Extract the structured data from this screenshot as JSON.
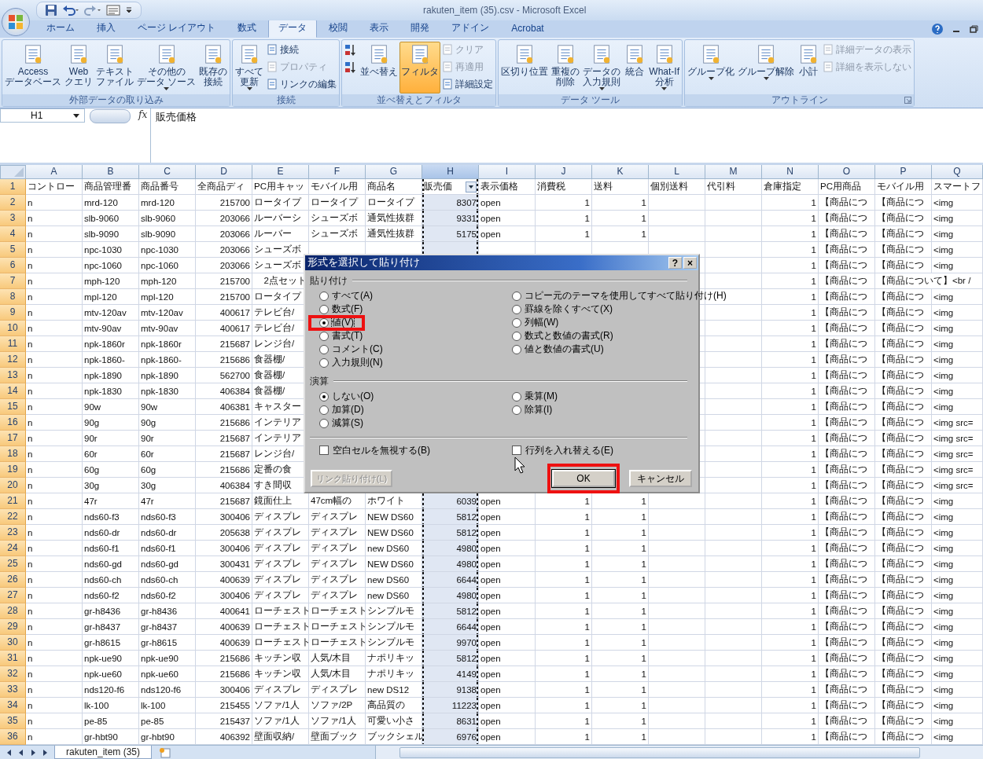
{
  "window": {
    "title": "rakuten_item (35).csv - Microsoft Excel"
  },
  "tabs": [
    {
      "label": "ホーム",
      "selected": false
    },
    {
      "label": "挿入",
      "selected": false
    },
    {
      "label": "ページ レイアウト",
      "selected": false
    },
    {
      "label": "数式",
      "selected": false
    },
    {
      "label": "データ",
      "selected": true
    },
    {
      "label": "校閲",
      "selected": false
    },
    {
      "label": "表示",
      "selected": false
    },
    {
      "label": "開発",
      "selected": false
    },
    {
      "label": "アドイン",
      "selected": false
    },
    {
      "label": "Acrobat",
      "selected": false
    }
  ],
  "ribbon": {
    "groups": [
      {
        "label": "外部データの取り込み",
        "buttons": [
          {
            "kind": "large",
            "lines": [
              "Access",
              "データベース"
            ]
          },
          {
            "kind": "large",
            "lines": [
              "Web",
              "クエリ"
            ]
          },
          {
            "kind": "large",
            "lines": [
              "テキスト",
              "ファイル"
            ]
          },
          {
            "kind": "large",
            "lines": [
              "その他の",
              "データ ソース"
            ],
            "dropdown": true
          },
          {
            "kind": "large",
            "lines": [
              "既存の",
              "接続"
            ]
          }
        ]
      },
      {
        "label": "接続",
        "buttons": [
          {
            "kind": "large",
            "lines": [
              "すべて",
              "更新"
            ],
            "dropdown": true
          },
          {
            "kind": "small",
            "lines": [
              "接続"
            ]
          },
          {
            "kind": "small",
            "lines": [
              "プロパティ"
            ],
            "disabled": true
          },
          {
            "kind": "small",
            "lines": [
              "リンクの編集"
            ]
          }
        ]
      },
      {
        "label": "並べ替えとフィルタ",
        "buttons": [
          {
            "kind": "icon"
          },
          {
            "kind": "icon"
          },
          {
            "kind": "large",
            "lines": [
              "並べ替え"
            ]
          },
          {
            "kind": "large",
            "lines": [
              "フィルタ"
            ],
            "selected": true
          },
          {
            "kind": "small",
            "lines": [
              "クリア"
            ],
            "disabled": true
          },
          {
            "kind": "small",
            "lines": [
              "再適用"
            ],
            "disabled": true
          },
          {
            "kind": "small",
            "lines": [
              "詳細設定"
            ]
          }
        ]
      },
      {
        "label": "データ ツール",
        "buttons": [
          {
            "kind": "large",
            "lines": [
              "区切り位置"
            ]
          },
          {
            "kind": "large",
            "lines": [
              "重複の",
              "削除"
            ]
          },
          {
            "kind": "large",
            "lines": [
              "データの",
              "入力規則"
            ],
            "dropdown": true
          },
          {
            "kind": "large",
            "lines": [
              "統合"
            ]
          },
          {
            "kind": "large",
            "lines": [
              "What-If",
              "分析"
            ],
            "dropdown": true
          }
        ]
      },
      {
        "label": "アウトライン",
        "has_launcher": true,
        "buttons": [
          {
            "kind": "large",
            "lines": [
              "グループ化"
            ],
            "dropdown": true
          },
          {
            "kind": "large",
            "lines": [
              "グループ解除"
            ],
            "dropdown": true
          },
          {
            "kind": "large",
            "lines": [
              "小計"
            ]
          },
          {
            "kind": "small",
            "lines": [
              "詳細データの表示"
            ],
            "disabled": true
          },
          {
            "kind": "small",
            "lines": [
              "詳細を表示しない"
            ],
            "disabled": true
          }
        ]
      }
    ]
  },
  "formula_bar": {
    "name_box": "H1",
    "fx_label": "fx",
    "value": "販売価格"
  },
  "sheet": {
    "columns": [
      {
        "label": "A",
        "selected": false
      },
      {
        "label": "B",
        "selected": false
      },
      {
        "label": "C",
        "selected": false
      },
      {
        "label": "D",
        "selected": false
      },
      {
        "label": "E",
        "selected": false
      },
      {
        "label": "F",
        "selected": false
      },
      {
        "label": "G",
        "selected": false
      },
      {
        "label": "H",
        "selected": true
      },
      {
        "label": "I",
        "selected": false
      },
      {
        "label": "J",
        "selected": false
      },
      {
        "label": "K",
        "selected": false
      },
      {
        "label": "L",
        "selected": false
      },
      {
        "label": "M",
        "selected": false
      },
      {
        "label": "N",
        "selected": false
      },
      {
        "label": "O",
        "selected": false
      },
      {
        "label": "P",
        "selected": false
      },
      {
        "label": "Q",
        "selected": false
      }
    ],
    "rows": [
      {
        "num": "1",
        "cells": [
          "コントロー",
          "商品管理番",
          "商品番号",
          "全商品ディ",
          "PC用キャッ",
          "モバイル用",
          "商品名",
          "販売価",
          "表示価格",
          "消費税",
          "送料",
          "個別送料",
          "代引料",
          "倉庫指定",
          "PC用商品",
          "モバイル用",
          "スマートフ"
        ]
      },
      {
        "num": "2",
        "cells": [
          "n",
          "mrd-120",
          "mrd-120",
          "215700",
          "ロータイプ",
          "ロータイプ",
          "ロータイプ",
          "8307",
          "open",
          "1",
          "1",
          null,
          null,
          "1",
          "【商品につ",
          "【商品につ",
          "<img"
        ]
      },
      {
        "num": "3",
        "cells": [
          "n",
          "slb-9060",
          "slb-9060",
          "203066",
          "ルーバーシ",
          "シューズボ",
          "通気性抜群",
          "9331",
          "open",
          "1",
          "1",
          null,
          null,
          "1",
          "【商品につ",
          "【商品につ",
          "<img"
        ]
      },
      {
        "num": "4",
        "cells": [
          "n",
          "slb-9090",
          "slb-9090",
          "203066",
          "ルーバー",
          "シューズボ",
          "通気性抜群",
          "5175",
          "open",
          "1",
          "1",
          null,
          null,
          "1",
          "【商品につ",
          "【商品につ",
          "<img"
        ]
      },
      {
        "num": "5",
        "cells": [
          "n",
          "npc-1030",
          "npc-1030",
          "203066",
          "シューズボ",
          null,
          null,
          null,
          null,
          null,
          null,
          null,
          null,
          "1",
          "【商品につ",
          "【商品につ",
          "<img"
        ]
      },
      {
        "num": "6",
        "cells": [
          "n",
          "npc-1060",
          "npc-1060",
          "203066",
          "シューズボ",
          null,
          null,
          null,
          null,
          null,
          null,
          null,
          null,
          "1",
          "【商品につ",
          "【商品につ",
          "<img"
        ]
      },
      {
        "num": "7",
        "cells": [
          "n",
          "mph-120",
          "mph-120",
          "215700",
          "2点セット",
          null,
          null,
          null,
          null,
          null,
          null,
          null,
          null,
          "1",
          "【商品につ",
          "【商品について】<br /",
          null
        ]
      },
      {
        "num": "8",
        "cells": [
          "n",
          "mpl-120",
          "mpl-120",
          "215700",
          "ロータイプ",
          null,
          null,
          null,
          null,
          null,
          null,
          null,
          null,
          "1",
          "【商品につ",
          "【商品につ",
          "<img"
        ]
      },
      {
        "num": "9",
        "cells": [
          "n",
          "mtv-120av",
          "mtv-120av",
          "400617",
          "テレビ台/",
          null,
          null,
          null,
          null,
          null,
          null,
          null,
          null,
          "1",
          "【商品につ",
          "【商品につ",
          "<img"
        ]
      },
      {
        "num": "10",
        "cells": [
          "n",
          "mtv-90av",
          "mtv-90av",
          "400617",
          "テレビ台/",
          null,
          null,
          null,
          null,
          null,
          null,
          null,
          null,
          "1",
          "【商品につ",
          "【商品につ",
          "<img"
        ]
      },
      {
        "num": "11",
        "cells": [
          "n",
          "npk-1860r",
          "npk-1860r",
          "215687",
          "レンジ台/",
          null,
          null,
          null,
          null,
          null,
          null,
          null,
          null,
          "1",
          "【商品につ",
          "【商品につ",
          "<img"
        ]
      },
      {
        "num": "12",
        "cells": [
          "n",
          "npk-1860-",
          "npk-1860-",
          "215686",
          "食器棚/",
          null,
          null,
          null,
          null,
          null,
          null,
          null,
          null,
          "1",
          "【商品につ",
          "【商品につ",
          "<img"
        ]
      },
      {
        "num": "13",
        "cells": [
          "n",
          "npk-1890",
          "npk-1890",
          "562700",
          "食器棚/",
          null,
          null,
          null,
          null,
          null,
          null,
          null,
          null,
          "1",
          "【商品につ",
          "【商品につ",
          "<img"
        ]
      },
      {
        "num": "14",
        "cells": [
          "n",
          "npk-1830",
          "npk-1830",
          "406384",
          "食器棚/",
          null,
          null,
          null,
          null,
          null,
          null,
          null,
          null,
          "1",
          "【商品につ",
          "【商品につ",
          "<img"
        ]
      },
      {
        "num": "15",
        "cells": [
          "n",
          "90w",
          "90w",
          "406381",
          "キャスター",
          null,
          null,
          null,
          null,
          null,
          null,
          null,
          null,
          "1",
          "【商品につ",
          "【商品につ",
          "<img"
        ]
      },
      {
        "num": "16",
        "cells": [
          "n",
          "90g",
          "90g",
          "215686",
          "インテリア",
          null,
          null,
          null,
          null,
          null,
          null,
          null,
          null,
          "1",
          "【商品につ",
          "【商品につ",
          "<img src="
        ]
      },
      {
        "num": "17",
        "cells": [
          "n",
          "90r",
          "90r",
          "215687",
          "インテリア",
          null,
          null,
          null,
          null,
          null,
          null,
          null,
          null,
          "1",
          "【商品につ",
          "【商品につ",
          "<img src="
        ]
      },
      {
        "num": "18",
        "cells": [
          "n",
          "60r",
          "60r",
          "215687",
          "レンジ台/",
          null,
          null,
          null,
          null,
          null,
          null,
          null,
          null,
          "1",
          "【商品につ",
          "【商品につ",
          "<img src="
        ]
      },
      {
        "num": "19",
        "cells": [
          "n",
          "60g",
          "60g",
          "215686",
          "定番の食",
          null,
          null,
          null,
          null,
          null,
          null,
          null,
          null,
          "1",
          "【商品につ",
          "【商品につ",
          "<img src="
        ]
      },
      {
        "num": "20",
        "cells": [
          "n",
          "30g",
          "30g",
          "406384",
          "すき間収",
          null,
          null,
          null,
          null,
          null,
          null,
          null,
          null,
          "1",
          "【商品につ",
          "【商品につ",
          "<img src="
        ]
      },
      {
        "num": "21",
        "cells": [
          "n",
          "47r",
          "47r",
          "215687",
          "鏡面仕上",
          "47cm幅の",
          "ホワイト",
          "6039",
          "open",
          "1",
          "1",
          null,
          null,
          "1",
          "【商品につ",
          "【商品につ",
          "<img"
        ]
      },
      {
        "num": "22",
        "cells": [
          "n",
          "nds60-f3",
          "nds60-f3",
          "300406",
          "ディスプレ",
          "ディスプレ",
          "NEW DS60",
          "5812",
          "open",
          "1",
          "1",
          null,
          null,
          "1",
          "【商品につ",
          "【商品につ",
          "<img"
        ]
      },
      {
        "num": "23",
        "cells": [
          "n",
          "nds60-dr",
          "nds60-dr",
          "205638",
          "ディスプレ",
          "ディスプレ",
          "NEW DS60",
          "5812",
          "open",
          "1",
          "1",
          null,
          null,
          "1",
          "【商品につ",
          "【商品につ",
          "<img"
        ]
      },
      {
        "num": "24",
        "cells": [
          "n",
          "nds60-f1",
          "nds60-f1",
          "300406",
          "ディスプレ",
          "ディスプレ",
          "new DS60",
          "4980",
          "open",
          "1",
          "1",
          null,
          null,
          "1",
          "【商品につ",
          "【商品につ",
          "<img"
        ]
      },
      {
        "num": "25",
        "cells": [
          "n",
          "nds60-gd",
          "nds60-gd",
          "300431",
          "ディスプレ",
          "ディスプレ",
          "NEW DS60",
          "4980",
          "open",
          "1",
          "1",
          null,
          null,
          "1",
          "【商品につ",
          "【商品につ",
          "<img"
        ]
      },
      {
        "num": "26",
        "cells": [
          "n",
          "nds60-ch",
          "nds60-ch",
          "400639",
          "ディスプレ",
          "ディスプレ",
          "new DS60",
          "6644",
          "open",
          "1",
          "1",
          null,
          null,
          "1",
          "【商品につ",
          "【商品につ",
          "<img"
        ]
      },
      {
        "num": "27",
        "cells": [
          "n",
          "nds60-f2",
          "nds60-f2",
          "300406",
          "ディスプレ",
          "ディスプレ",
          "new DS60",
          "4980",
          "open",
          "1",
          "1",
          null,
          null,
          "1",
          "【商品につ",
          "【商品につ",
          "<img"
        ]
      },
      {
        "num": "28",
        "cells": [
          "n",
          "gr-h8436",
          "gr-h8436",
          "400641",
          "ローチェスト",
          "ローチェスト",
          "シンプルモ",
          "5812",
          "open",
          "1",
          "1",
          null,
          null,
          "1",
          "【商品につ",
          "【商品につ",
          "<img"
        ]
      },
      {
        "num": "29",
        "cells": [
          "n",
          "gr-h8437",
          "gr-h8437",
          "400639",
          "ローチェスト",
          "ローチェスト",
          "シンプルモ",
          "6644",
          "open",
          "1",
          "1",
          null,
          null,
          "1",
          "【商品につ",
          "【商品につ",
          "<img"
        ]
      },
      {
        "num": "30",
        "cells": [
          "n",
          "gr-h8615",
          "gr-h8615",
          "400639",
          "ローチェスト",
          "ローチェスト",
          "シンプルモ",
          "9970",
          "open",
          "1",
          "1",
          null,
          null,
          "1",
          "【商品につ",
          "【商品につ",
          "<img"
        ]
      },
      {
        "num": "31",
        "cells": [
          "n",
          "npk-ue90",
          "npk-ue90",
          "215686",
          "キッチン収",
          "人気/木目",
          "ナポリキッ",
          "5812",
          "open",
          "1",
          "1",
          null,
          null,
          "1",
          "【商品につ",
          "【商品につ",
          "<img"
        ]
      },
      {
        "num": "32",
        "cells": [
          "n",
          "npk-ue60",
          "npk-ue60",
          "215686",
          "キッチン収",
          "人気/木目",
          "ナポリキッ",
          "4149",
          "open",
          "1",
          "1",
          null,
          null,
          "1",
          "【商品につ",
          "【商品につ",
          "<img"
        ]
      },
      {
        "num": "33",
        "cells": [
          "n",
          "nds120-f6",
          "nds120-f6",
          "300406",
          "ディスプレ",
          "ディスプレ",
          "new DS12",
          "9138",
          "open",
          "1",
          "1",
          null,
          null,
          "1",
          "【商品につ",
          "【商品につ",
          "<img"
        ]
      },
      {
        "num": "34",
        "cells": [
          "n",
          "lk-100",
          "lk-100",
          "215455",
          "ソファ/1人",
          "ソファ/2P",
          "高品質の",
          "11223",
          "open",
          "1",
          "1",
          null,
          null,
          "1",
          "【商品につ",
          "【商品につ",
          "<img"
        ]
      },
      {
        "num": "35",
        "cells": [
          "n",
          "pe-85",
          "pe-85",
          "215437",
          "ソファ/1人",
          "ソファ/1人",
          "可愛い小さ",
          "8631",
          "open",
          "1",
          "1",
          null,
          null,
          "1",
          "【商品につ",
          "【商品につ",
          "<img"
        ]
      },
      {
        "num": "36",
        "cells": [
          "n",
          "gr-hbt90",
          "gr-hbt90",
          "406392",
          "壁面収納/",
          "壁面ブック",
          "ブックシェル",
          "6976",
          "open",
          "1",
          "1",
          null,
          null,
          "1",
          "【商品につ",
          "【商品につ",
          "<img"
        ]
      }
    ]
  },
  "sheet_tabs": [
    {
      "label": "rakuten_item (35)",
      "selected": true
    }
  ],
  "dialog": {
    "title": "形式を選択して貼り付け",
    "help_button": "?",
    "close_button": "×",
    "paste": {
      "label": "貼り付け",
      "left": [
        {
          "label": "すべて(A)",
          "selected": false,
          "highlighted": false
        },
        {
          "label": "数式(F)",
          "selected": false,
          "highlighted": false
        },
        {
          "label": "値(V)",
          "selected": true,
          "highlighted": true
        },
        {
          "label": "書式(T)",
          "selected": false,
          "highlighted": false
        },
        {
          "label": "コメント(C)",
          "selected": false,
          "highlighted": false
        },
        {
          "label": "入力規則(N)",
          "selected": false,
          "highlighted": false
        }
      ],
      "right": [
        {
          "label": "コピー元のテーマを使用してすべて貼り付け(H)",
          "selected": false,
          "highlighted": false
        },
        {
          "label": "罫線を除くすべて(X)",
          "selected": false,
          "highlighted": false
        },
        {
          "label": "列幅(W)",
          "selected": false,
          "highlighted": false
        },
        {
          "label": "数式と数値の書式(R)",
          "selected": false,
          "highlighted": false
        },
        {
          "label": "値と数値の書式(U)",
          "selected": false,
          "highlighted": false
        }
      ]
    },
    "operation": {
      "label": "演算",
      "left": [
        {
          "label": "しない(O)",
          "selected": true,
          "highlighted": false
        },
        {
          "label": "加算(D)",
          "selected": false,
          "highlighted": false
        },
        {
          "label": "減算(S)",
          "selected": false,
          "highlighted": false
        }
      ],
      "right": [
        {
          "label": "乗算(M)",
          "selected": false,
          "highlighted": false
        },
        {
          "label": "除算(I)",
          "selected": false,
          "highlighted": false
        }
      ]
    },
    "checkboxes": [
      {
        "label": "空白セルを無視する(B)",
        "checked": false
      },
      {
        "label": "行列を入れ替える(E)",
        "checked": false
      }
    ],
    "buttons": [
      {
        "label": "リンク貼り付け(L)",
        "disabled": true,
        "highlighted": false
      },
      {
        "label": "OK",
        "disabled": false,
        "highlighted": true
      },
      {
        "label": "キャンセル",
        "disabled": false,
        "highlighted": false
      }
    ]
  }
}
